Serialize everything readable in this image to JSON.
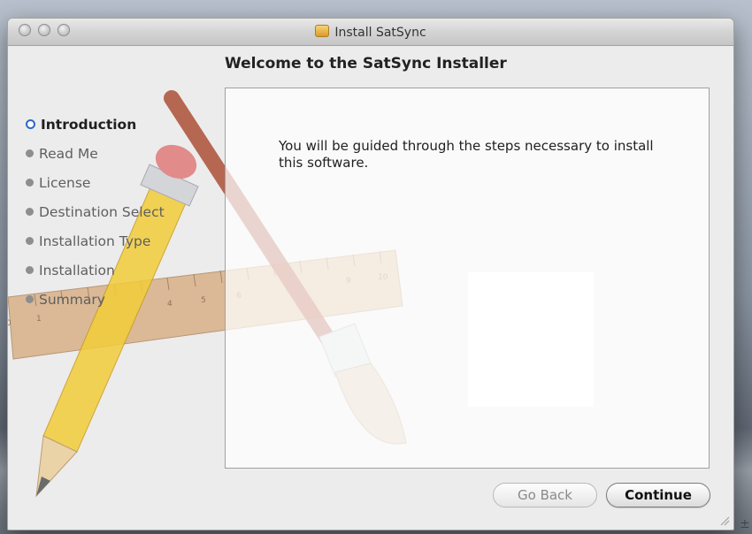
{
  "window": {
    "title": "Install SatSync",
    "heading": "Welcome to the SatSync Installer"
  },
  "steps": [
    {
      "label": "Introduction",
      "active": true
    },
    {
      "label": "Read Me",
      "active": false
    },
    {
      "label": "License",
      "active": false
    },
    {
      "label": "Destination Select",
      "active": false
    },
    {
      "label": "Installation Type",
      "active": false
    },
    {
      "label": "Installation",
      "active": false
    },
    {
      "label": "Summary",
      "active": false
    }
  ],
  "content": {
    "message": "You will be guided through the steps necessary to install this software."
  },
  "buttons": {
    "back": "Go Back",
    "continue": "Continue"
  },
  "artwork": {
    "ruler_ticks": [
      "0",
      "1",
      "4",
      "5",
      "6",
      "9",
      "10"
    ]
  },
  "stray_glyph": "±",
  "icons": [
    "close-button",
    "minimize-button",
    "zoom-button",
    "package-icon",
    "resize-grip-icon"
  ]
}
